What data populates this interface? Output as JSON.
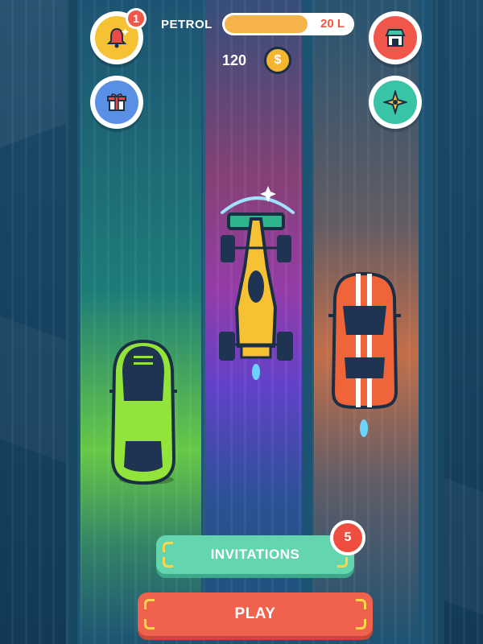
{
  "hud": {
    "notification_badge": "1",
    "petrol_label": "PETROL",
    "petrol_value": "20 L",
    "petrol_level_percent": 65,
    "coins": "120"
  },
  "buttons": {
    "invitations_label": "INVITATIONS",
    "invitations_count": "5",
    "play_label": "PLAY"
  },
  "icons": {
    "notifications": "bell-icon",
    "gifts": "gift-icon",
    "shop": "shop-icon",
    "settings": "shuriken-icon",
    "coin": "coin-icon"
  },
  "colors": {
    "notification_bg": "#f6c233",
    "gift_bg": "#5a8fe6",
    "shop_bg": "#f0574a",
    "settings_bg": "#39c4a6",
    "petrol_fill": "#f6b24b",
    "invitations": "#63d6b0",
    "play": "#f0614e"
  }
}
